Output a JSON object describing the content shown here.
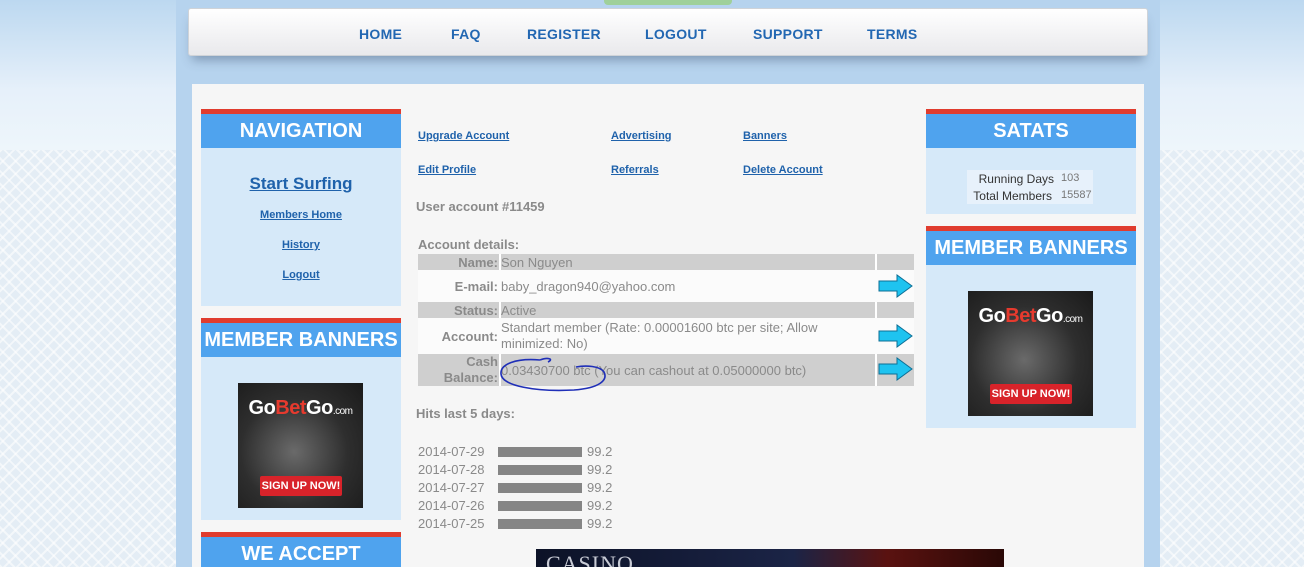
{
  "nav": [
    "HOME",
    "FAQ",
    "REGISTER",
    "LOGOUT",
    "SUPPORT",
    "TERMS"
  ],
  "left": {
    "navigation_title": "NAVIGATION",
    "start_surfing": "Start Surfing",
    "links": [
      "Members Home",
      "History",
      "Logout"
    ],
    "member_banners_title": "MEMBER BANNERS",
    "we_accept_title": "WE ACCEPT"
  },
  "ad": {
    "brand_1": "Go",
    "brand_2": "Bet",
    "brand_3": "Go",
    "tld": ".com",
    "cta": "SIGN UP NOW!"
  },
  "main": {
    "links_row1": [
      "Upgrade Account",
      "Advertising",
      "Banners"
    ],
    "links_row2": [
      "Edit Profile",
      "Referrals",
      "Delete Account"
    ],
    "user_account": "User account #11459",
    "account_details": "Account details:",
    "details": {
      "name_label": "Name:",
      "name_value": "Son Nguyen",
      "email_label": "E-mail:",
      "email_value": "baby_dragon940@yahoo.com",
      "status_label": "Status:",
      "status_value": "Active",
      "account_label": "Account:",
      "account_value": "Standart member (Rate: 0.00001600 btc per site; Allow minimized: No)",
      "cash_label_1": "Cash",
      "cash_label_2": "Balance:",
      "cash_value": "0.03430700 btc (You can cashout at 0.05000000 btc)"
    },
    "hits_title": "Hits last 5 days:",
    "hits": [
      {
        "date": "2014-07-29",
        "value": "99.2"
      },
      {
        "date": "2014-07-28",
        "value": "99.2"
      },
      {
        "date": "2014-07-27",
        "value": "99.2"
      },
      {
        "date": "2014-07-26",
        "value": "99.2"
      },
      {
        "date": "2014-07-25",
        "value": "99.2"
      }
    ],
    "casino_banner_text": "CASINO"
  },
  "right": {
    "stats_title": "SATATS",
    "running_days_label": "Running Days",
    "running_days_value": "103",
    "total_members_label": "Total Members",
    "total_members_value": "15587",
    "member_banners_title": "MEMBER BANNERS"
  },
  "colors": {
    "accent_red": "#e03c2e",
    "header_blue": "#4fa3ee",
    "link_blue": "#1f62ab",
    "arrow_cyan": "#1ec3f0",
    "annotation_ink": "#1f2fb8"
  },
  "icons": {
    "row_action": "right-arrow-icon"
  }
}
